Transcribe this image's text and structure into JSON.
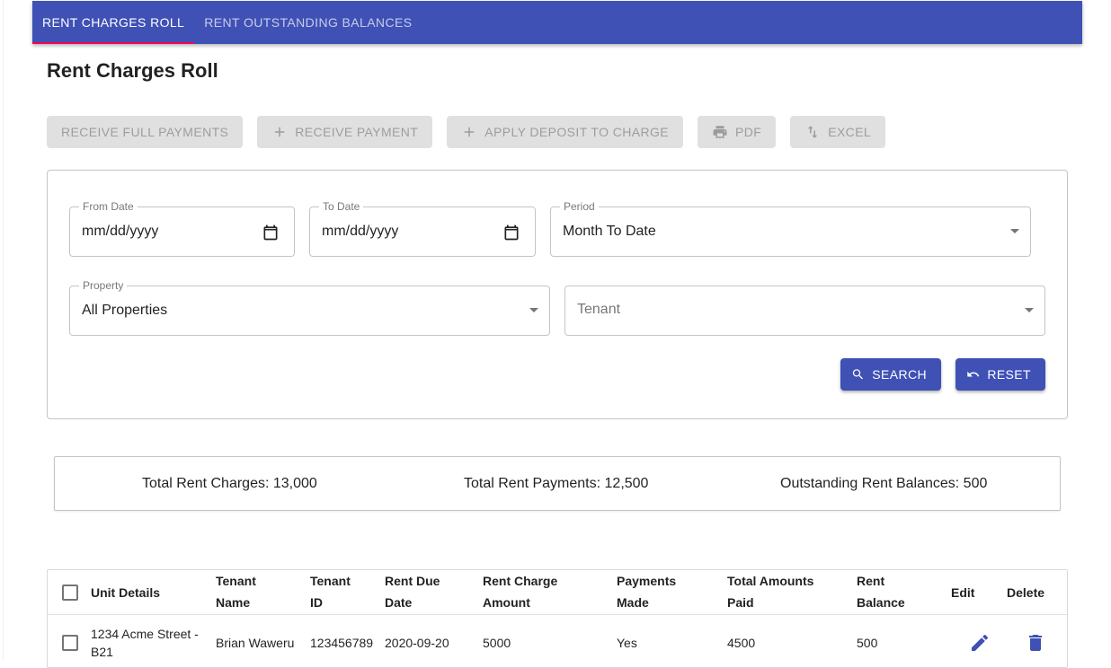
{
  "tabs": [
    {
      "label": "RENT CHARGES ROLL",
      "active": true
    },
    {
      "label": "RENT OUTSTANDING BALANCES",
      "active": false
    }
  ],
  "page_title": "Rent Charges Roll",
  "actions": {
    "receive_full": "RECEIVE FULL PAYMENTS",
    "receive_payment": "RECEIVE PAYMENT",
    "apply_deposit": "APPLY DEPOSIT TO CHARGE",
    "pdf": "PDF",
    "excel": "EXCEL"
  },
  "filters": {
    "from_date": {
      "label": "From Date",
      "value": "mm/dd/yyyy"
    },
    "to_date": {
      "label": "To Date",
      "value": "mm/dd/yyyy"
    },
    "period": {
      "label": "Period",
      "value": "Month To Date"
    },
    "property": {
      "label": "Property",
      "value": "All Properties"
    },
    "tenant": {
      "placeholder": "Tenant"
    },
    "search_label": "SEARCH",
    "reset_label": "RESET"
  },
  "summary": {
    "total_charges": "Total Rent Charges: 13,000",
    "total_payments": "Total Rent Payments: 12,500",
    "outstanding": "Outstanding Rent Balances: 500"
  },
  "table": {
    "headers": {
      "unit": "Unit Details",
      "tenant_name_1": "Tenant",
      "tenant_name_2": "Name",
      "tenant_id_1": "Tenant",
      "tenant_id_2": "ID",
      "due_1": "Rent Due",
      "due_2": "Date",
      "charge_1": "Rent Charge",
      "charge_2": "Amount",
      "payments_1": "Payments",
      "payments_2": "Made",
      "paid_1": "Total Amounts",
      "paid_2": "Paid",
      "balance_1": "Rent",
      "balance_2": "Balance",
      "edit": "Edit",
      "delete": "Delete"
    },
    "rows": [
      {
        "unit_1": "1234 Acme Street -",
        "unit_2": "B21",
        "tenant_name": "Brian Waweru",
        "tenant_id": "123456789",
        "due_date": "2020-09-20",
        "charge_amount": "5000",
        "payments_made": "Yes",
        "total_paid": "4500",
        "balance": "500"
      }
    ]
  },
  "colors": {
    "primary": "#3f51b5",
    "tab_indicator": "#f50057",
    "disabled_bg": "#e0e0e0"
  },
  "icons": [
    "plus-icon",
    "print-icon",
    "swap-vert-icon",
    "calendar-icon",
    "search-icon",
    "undo-icon",
    "edit-icon",
    "delete-icon"
  ]
}
